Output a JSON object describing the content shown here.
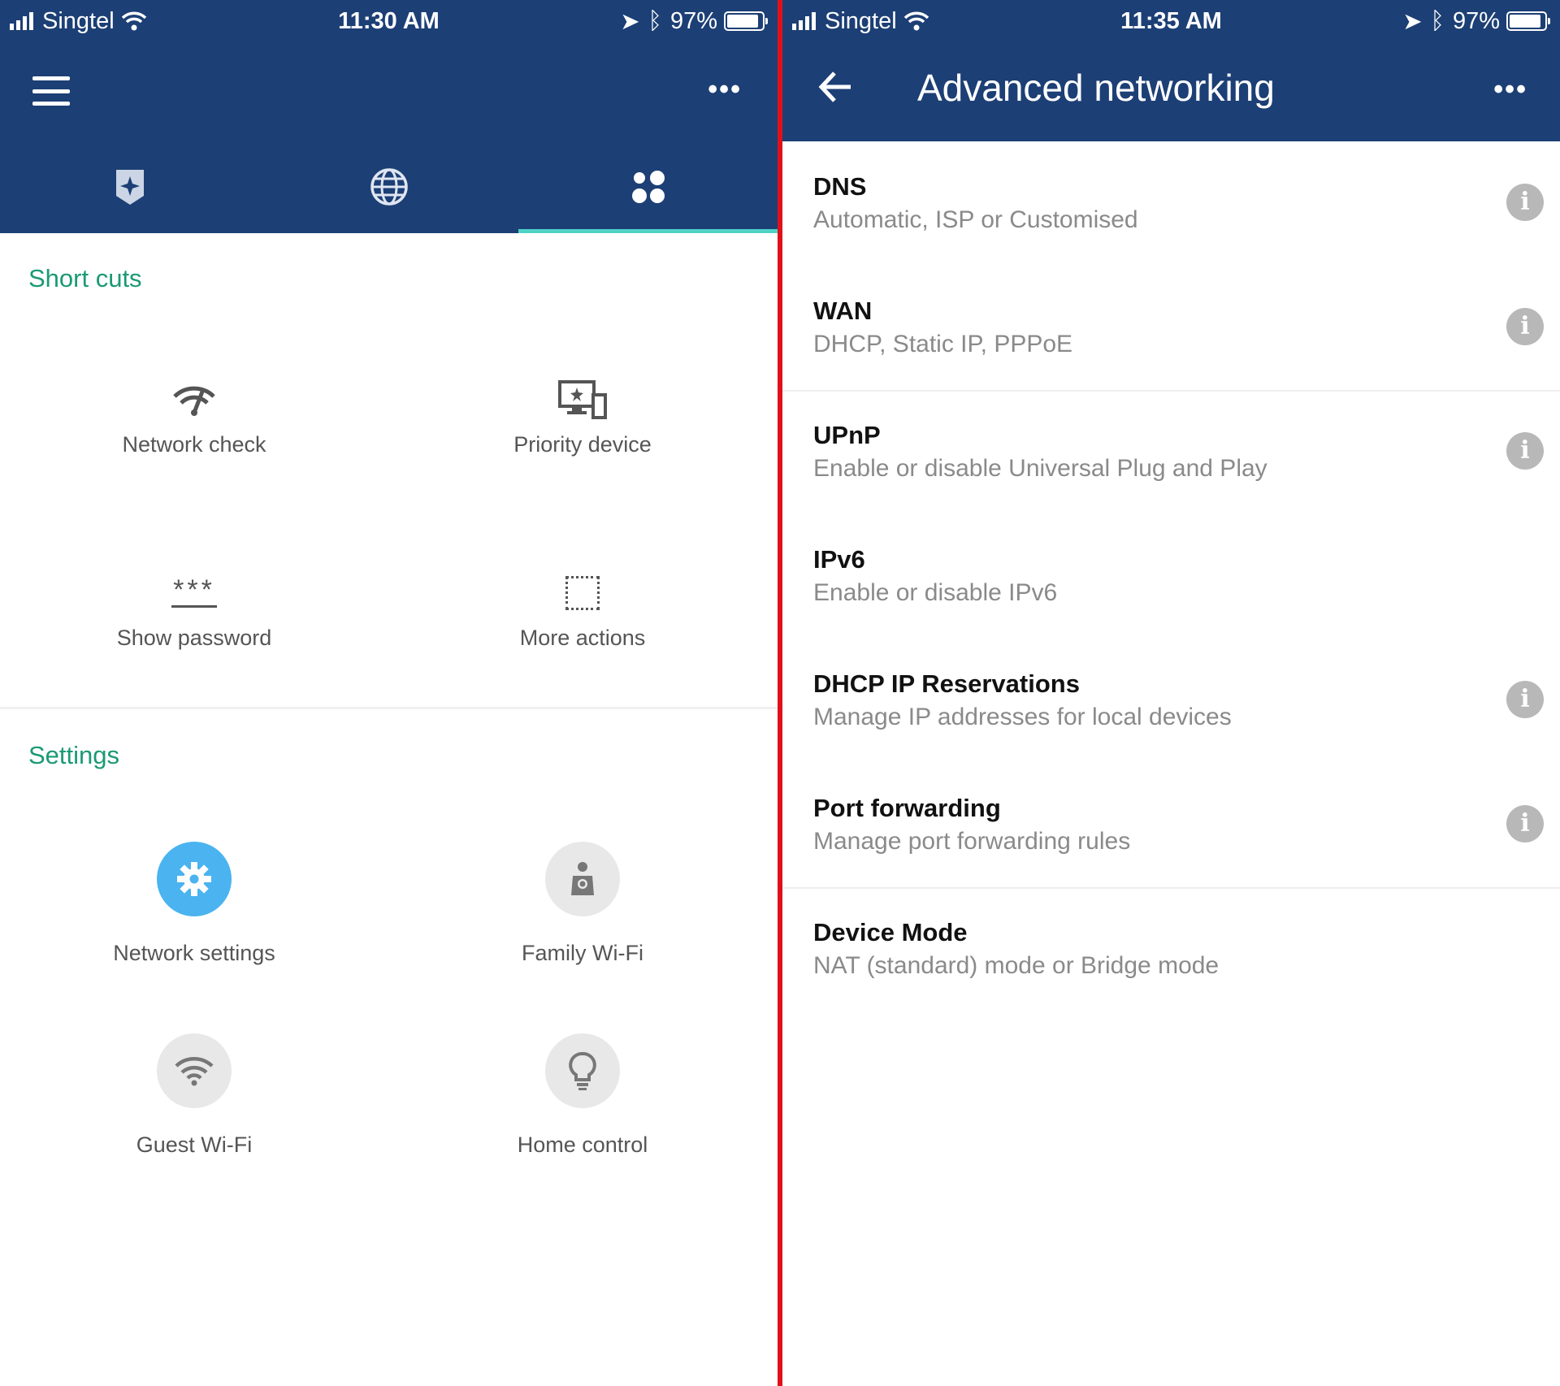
{
  "left": {
    "status": {
      "carrier": "Singtel",
      "time": "11:30 AM",
      "battery": "97%"
    },
    "tabs": [
      {
        "icon": "star-badge-icon"
      },
      {
        "icon": "globe-icon"
      },
      {
        "icon": "grid-apps-icon",
        "active": true
      }
    ],
    "shortcuts": {
      "title": "Short cuts",
      "items": [
        {
          "label": "Network check",
          "icon": "network-check-icon"
        },
        {
          "label": "Priority device",
          "icon": "priority-device-icon"
        },
        {
          "label": "Show password",
          "icon": "password-icon"
        },
        {
          "label": "More actions",
          "icon": "dotted-square-icon"
        }
      ]
    },
    "settings": {
      "title": "Settings",
      "items": [
        {
          "label": "Network settings",
          "icon": "gear-icon",
          "active": true
        },
        {
          "label": "Family Wi-Fi",
          "icon": "family-icon"
        },
        {
          "label": "Guest Wi-Fi",
          "icon": "wifi-icon"
        },
        {
          "label": "Home control",
          "icon": "lightbulb-icon"
        }
      ]
    },
    "password_glyph": "***"
  },
  "right": {
    "status": {
      "carrier": "Singtel",
      "time": "11:35 AM",
      "battery": "97%"
    },
    "title": "Advanced networking",
    "items": [
      {
        "title": "DNS",
        "subtitle": "Automatic, ISP or Customised",
        "info": true
      },
      {
        "title": "WAN",
        "subtitle": "DHCP, Static IP, PPPoE",
        "info": true
      },
      {
        "title": "UPnP",
        "subtitle": "Enable or disable Universal Plug and Play",
        "info": true
      },
      {
        "title": "IPv6",
        "subtitle": "Enable or disable IPv6",
        "info": false
      },
      {
        "title": "DHCP IP Reservations",
        "subtitle": "Manage IP addresses for local devices",
        "info": true
      },
      {
        "title": "Port forwarding",
        "subtitle": "Manage port forwarding rules",
        "info": true
      },
      {
        "title": "Device Mode",
        "subtitle": "NAT (standard) mode or Bridge mode",
        "info": false
      }
    ]
  },
  "colors": {
    "header": "#1c3f75",
    "accent_green": "#1a9a74",
    "tab_underline": "#4fd2c6",
    "active_circle": "#4ab3f0",
    "divider": "#e0101a"
  }
}
